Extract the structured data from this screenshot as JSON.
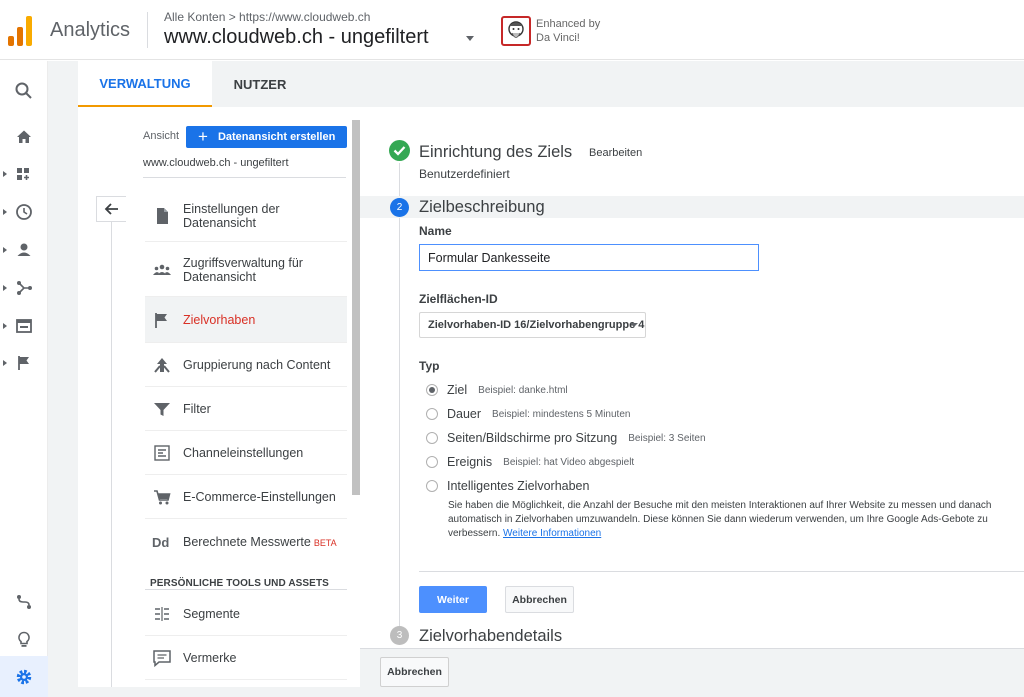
{
  "header": {
    "app_name": "Analytics",
    "breadcrumb": "Alle Konten > https://www.cloudweb.ch",
    "property_title": "www.cloudweb.ch - ungefiltert",
    "extension_line1": "Enhanced by",
    "extension_line2": "Da Vinci!",
    "logo_colors": [
      "#f9ab00",
      "#e37400",
      "#e37400"
    ]
  },
  "rail": {
    "icons": [
      "search-icon",
      "home-icon",
      "customization-icon",
      "clock-icon",
      "person-icon",
      "acquisition-icon",
      "behavior-icon",
      "flag-icon",
      "route-icon",
      "lightbulb-icon",
      "gear-icon"
    ]
  },
  "tabs": {
    "admin": "VERWALTUNG",
    "user": "NUTZER"
  },
  "view": {
    "label": "Ansicht",
    "create_button": "Datenansicht erstellen",
    "name": "www.cloudweb.ch - ungefiltert",
    "items": [
      {
        "icon": "document-icon",
        "line1": "Einstellungen der",
        "line2": "Datenansicht"
      },
      {
        "icon": "people-icon",
        "line1": "Zugriffsverwaltung für",
        "line2": "Datenansicht"
      },
      {
        "icon": "flag-icon",
        "label": "Zielvorhaben"
      },
      {
        "icon": "grouping-icon",
        "label": "Gruppierung nach Content"
      },
      {
        "icon": "filter-icon",
        "label": "Filter"
      },
      {
        "icon": "channel-icon",
        "label": "Channeleinstellungen"
      },
      {
        "icon": "cart-icon",
        "label": "E-Commerce-Einstellungen"
      },
      {
        "icon": "dd-icon",
        "icon_text": "Dd",
        "label": "Berechnete Messwerte",
        "badge": "BETA"
      }
    ],
    "section_title": "PERSÖNLICHE TOOLS UND ASSETS",
    "tools": [
      {
        "icon": "segments-icon",
        "label": "Segmente"
      },
      {
        "icon": "annotation-icon",
        "label": "Vermerke"
      }
    ]
  },
  "goal": {
    "step1": {
      "title": "Einrichtung des Ziels",
      "edit": "Bearbeiten",
      "subtitle": "Benutzerdefiniert"
    },
    "step2": {
      "number": "2",
      "title": "Zielbeschreibung"
    },
    "name_label": "Name",
    "name_value": "Formular Dankesseite",
    "goal_id_label": "Zielflächen-ID",
    "goal_id_value": "Zielvorhaben-ID 16/Zielvorhabengruppe 4",
    "type_label": "Typ",
    "types": [
      {
        "label": "Ziel",
        "hint": "Beispiel: danke.html",
        "checked": true
      },
      {
        "label": "Dauer",
        "hint": "Beispiel: mindestens 5 Minuten",
        "checked": false
      },
      {
        "label": "Seiten/Bildschirme pro Sitzung",
        "hint": "Beispiel: 3 Seiten",
        "checked": false
      },
      {
        "label": "Ereignis",
        "hint": "Beispiel: hat Video abgespielt",
        "checked": false
      },
      {
        "label": "Intelligentes Zielvorhaben",
        "hint": "",
        "checked": false
      }
    ],
    "smart_description": "Sie haben die Möglichkeit, die Anzahl der Besuche mit den meisten Interaktionen auf Ihrer Website zu messen und danach automatisch in Zielvorhaben umzuwandeln. Diese können Sie dann wiederum verwenden, um Ihre Google Ads-Gebote zu verbessern.",
    "smart_link": "Weitere Informationen",
    "continue_button": "Weiter",
    "cancel_button": "Abbrechen",
    "step3": {
      "number": "3",
      "title": "Zielvorhabendetails"
    }
  },
  "footer": {
    "cancel_button": "Abbrechen"
  }
}
